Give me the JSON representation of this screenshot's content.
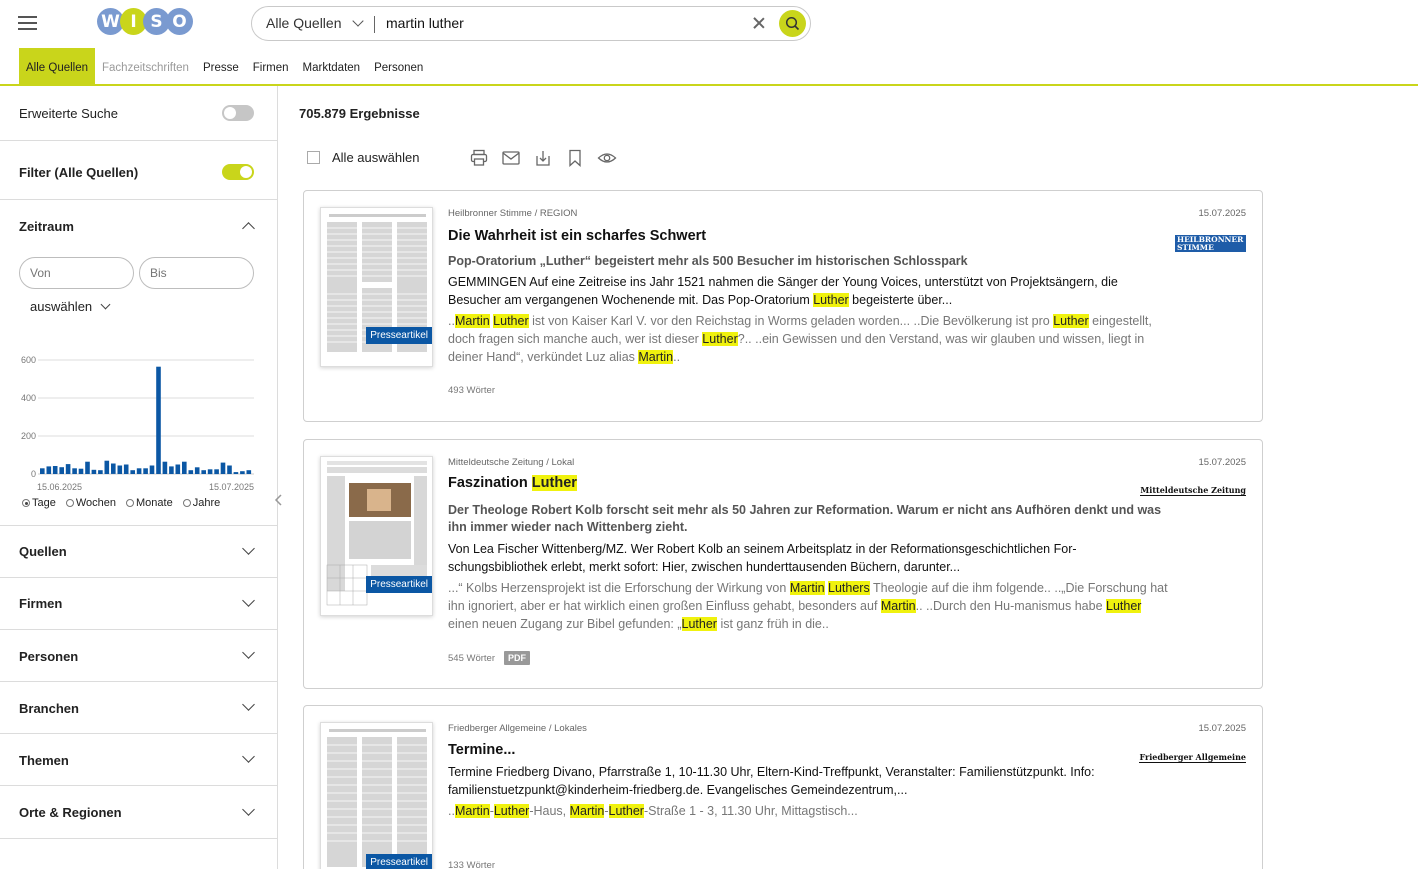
{
  "header": {
    "logo_letters": [
      "W",
      "I",
      "S",
      "O"
    ],
    "logo_colors": [
      "#7a9ad0",
      "#c9d51b",
      "#7a9ad0",
      "#7a9ad0"
    ],
    "source_select": "Alle Quellen",
    "query": "martin luther",
    "accent": "#c9d51b"
  },
  "tabs": [
    "Alle Quellen",
    "Fachzeitschriften",
    "Presse",
    "Firmen",
    "Marktdaten",
    "Personen"
  ],
  "sidebar": {
    "advanced_search": "Erweiterte Suche",
    "filter": "Filter (Alle Quellen)",
    "zeitraum": "Zeitraum",
    "from_placeholder": "Von",
    "to_placeholder": "Bis",
    "select_label": "auswählen",
    "histogram": {
      "y_ticks": [
        "600",
        "400",
        "200",
        "0"
      ],
      "x_start": "15.06.2025",
      "x_end": "15.07.2025",
      "ylim": [
        0,
        600
      ],
      "values": [
        30,
        40,
        42,
        36,
        52,
        30,
        28,
        65,
        22,
        20,
        70,
        55,
        45,
        50,
        20,
        30,
        30,
        45,
        565,
        65,
        40,
        50,
        65,
        20,
        35,
        20,
        25,
        25,
        60,
        45,
        10,
        15,
        20
      ],
      "bar_color": "#0b57a4"
    },
    "granularity": [
      "Tage",
      "Wochen",
      "Monate",
      "Jahre"
    ],
    "granularity_selected": "Tage",
    "facets": [
      "Quellen",
      "Firmen",
      "Personen",
      "Branchen",
      "Themen",
      "Orte & Regionen"
    ]
  },
  "results": {
    "count": "705.879 Ergebnisse",
    "select_all": "Alle auswählen",
    "toolbar_icons": [
      "print-icon",
      "mail-icon",
      "download-icon",
      "bookmark-icon",
      "view-icon"
    ],
    "badge": "Presseartikel",
    "items": [
      {
        "source": "Heilbronner Stimme / REGION",
        "date": "15.07.2025",
        "logo_text": "HEILBRONNER STIMME",
        "title": "Die Wahrheit ist ein scharfes Schwert",
        "lead": "Pop-Oratorium „Luther“ begeistert mehr als 500 Besucher im historischen Schlosspark",
        "body_a": "GEMMINGEN Auf eine Zeitreise ins Jahr 1521 nahmen die Sänger der Young Voices, unterstützt von Projektsängern, die Besucher am vergangenen Wochenende mit. Das Pop-Oratorium ",
        "body_hl": "Luther",
        "body_b": " begeisterte über...",
        "snip": [
          "..",
          "#Martin",
          " ",
          "#Luther",
          " ist von Kaiser Karl V. vor den Reichstag in Worms geladen worden... ..Die Bevölkerung ist pro ",
          "#Luther",
          " eingestellt, doch fragen sich manche auch, wer ist dieser ",
          "#Luther",
          "?.. ..ein Gewissen und den Verstand, was wir glauben und wissen, liegt in deiner Hand“, verkündet Luz alias ",
          "#Martin",
          ".."
        ],
        "words": "493 Wörter"
      },
      {
        "source": "Mitteldeutsche Zeitung / Lokal",
        "date": "15.07.2025",
        "logo_text": "Mitteldeutsche Zeitung",
        "title_a": "Faszination ",
        "title_hl": "Luther",
        "lead": "Der Theologe Robert Kolb forscht seit mehr als 50 Jahren zur Reformation. Warum er nicht ans Aufhören denkt und was ihn immer wieder nach Wittenberg zieht.",
        "body": "Von Lea Fischer Wittenberg/MZ. Wer Robert Kolb an seinem Arbeitsplatz in der Reformationsgeschichtlichen For-schungsbibliothek erlebt, merkt sofort: Hier, zwischen hunderttausenden Büchern, darunter...",
        "snip": [
          "...“ Kolbs Herzensprojekt ist die Erforschung der Wirkung von ",
          "#Martin",
          " ",
          "#Luthers",
          " Theologie auf die ihm folgende.. ..„Die Forschung hat ihn ignoriert, aber er hat wirklich einen großen Einfluss gehabt, besonders auf ",
          "#Martin",
          ".. ..Durch den Hu-manismus habe ",
          "#Luther",
          " einen neuen Zugang zur Bibel gefunden: „",
          "#Luther",
          " ist ganz früh in die.."
        ],
        "words": "545 Wörter",
        "pdf": "PDF"
      },
      {
        "source": "Friedberger Allgemeine / Lokales",
        "date": "15.07.2025",
        "logo_text": "Friedberger Allgemeine",
        "title": "Termine...",
        "body": "Termine Friedberg Divano, Pfarrstraße 1, 10-11.30 Uhr, Eltern-Kind-Treffpunkt, Veranstalter: Familienstützpunkt. Info: familienstuetzpunkt@kinderheim-friedberg.de. Evangelisches Gemeindezentrum,...",
        "snip": [
          "..",
          "#Martin",
          "-",
          "#Luther",
          "-Haus, ",
          "#Martin",
          "-",
          "#Luther",
          "-Straße 1 - 3, 11.30 Uhr, Mittagstisch..."
        ],
        "words": "133 Wörter"
      }
    ]
  }
}
